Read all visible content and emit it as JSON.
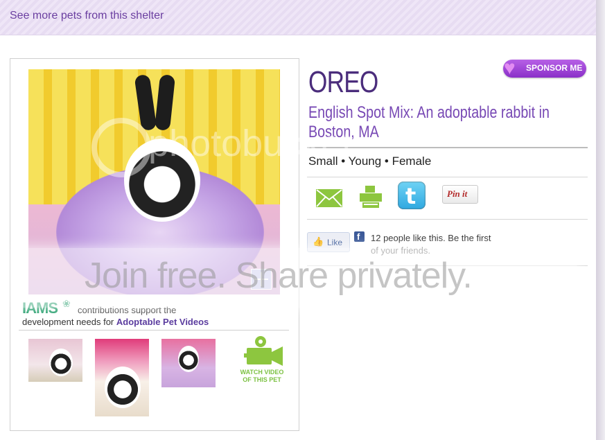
{
  "top_link": "See more pets from this shelter",
  "pet": {
    "name": "OREO",
    "breed_line": "English Spot Mix: An adoptable rabbit in Boston, MA",
    "attributes": "Small • Young • Female"
  },
  "sponsor_label": "SPONSOR ME",
  "iams": {
    "logo": "IAMS",
    "tagline_1": "contributions support the",
    "tagline_2_prefix": "development needs for ",
    "tagline_2_link": "Adoptable Pet Videos"
  },
  "video_label": "WATCH VIDEO OF THIS PET",
  "share": {
    "email_icon": "envelope-icon",
    "print_icon": "printer-icon",
    "twitter_icon": "twitter-icon",
    "pinit_label": "Pin it"
  },
  "facebook": {
    "like_label": "Like",
    "count_text": "12 people like this. Be the first",
    "count_text_2": "of your friends."
  },
  "watermark": {
    "brand": "photobucket",
    "slogan": "Join free. Share privately."
  },
  "colors": {
    "accent_purple": "#4b2d7c",
    "breed_purple": "#7748b4",
    "share_green": "#8dc63f",
    "facebook_blue": "#3b5998"
  }
}
